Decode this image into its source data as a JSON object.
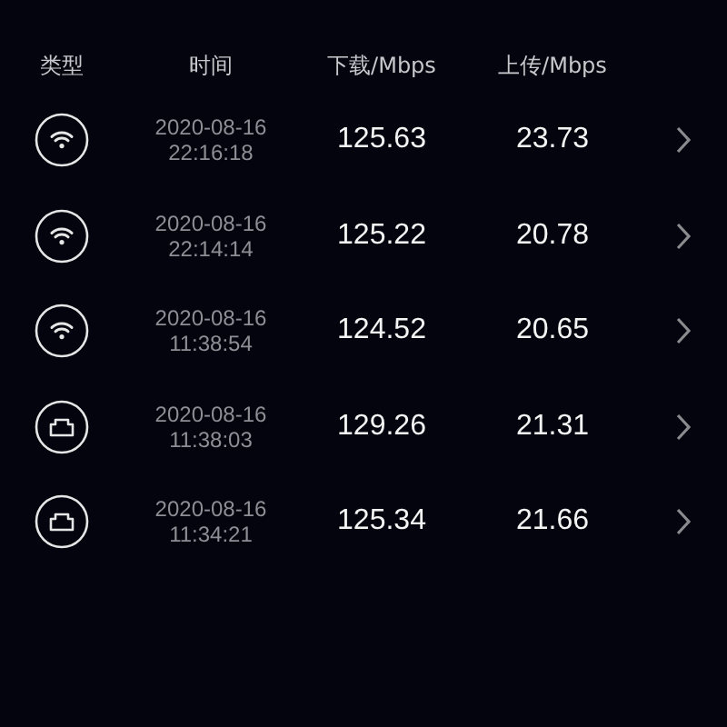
{
  "table": {
    "columns": [
      "类型",
      "时间",
      "下载/Mbps",
      "上传/Mbps"
    ],
    "rows": [
      {
        "kind": "wifi",
        "date": "2020-08-16",
        "time": "22:16:18",
        "download": "125.63",
        "upload": "23.73"
      },
      {
        "kind": "wifi",
        "date": "2020-08-16",
        "time": "22:14:14",
        "download": "125.22",
        "upload": "20.78"
      },
      {
        "kind": "wifi",
        "date": "2020-08-16",
        "time": "11:38:54",
        "download": "124.52",
        "upload": "20.65"
      },
      {
        "kind": "ethernet",
        "date": "2020-08-16",
        "time": "11:38:03",
        "download": "129.26",
        "upload": "21.31"
      },
      {
        "kind": "ethernet",
        "date": "2020-08-16",
        "time": "11:34:21",
        "download": "125.34",
        "upload": "21.66"
      }
    ]
  }
}
